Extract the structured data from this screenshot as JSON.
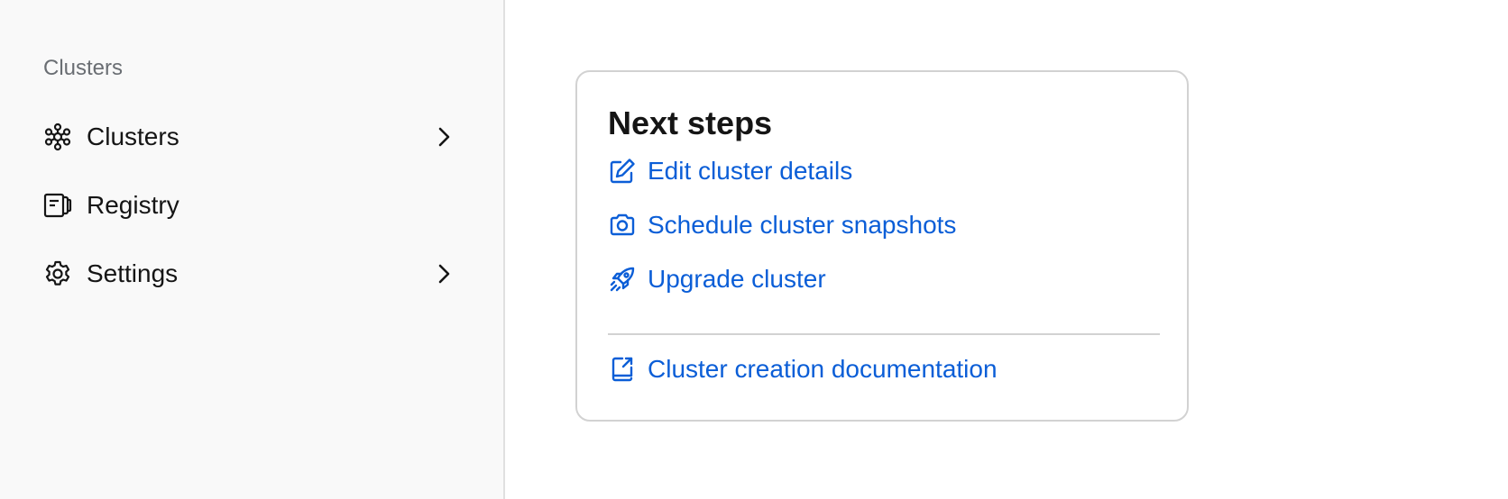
{
  "sidebar": {
    "heading": "Clusters",
    "items": [
      {
        "label": "Clusters",
        "icon": "clusters-icon",
        "has_submenu": true
      },
      {
        "label": "Registry",
        "icon": "registry-icon",
        "has_submenu": false
      },
      {
        "label": "Settings",
        "icon": "gear-icon",
        "has_submenu": true
      }
    ]
  },
  "card": {
    "title": "Next steps",
    "steps": [
      {
        "label": "Edit cluster details",
        "icon": "edit-icon"
      },
      {
        "label": "Schedule cluster snapshots",
        "icon": "camera-icon"
      },
      {
        "label": "Upgrade cluster",
        "icon": "rocket-icon"
      }
    ],
    "doc_link": {
      "label": "Cluster creation documentation",
      "icon": "external-doc-icon"
    }
  },
  "colors": {
    "link": "#0b5ed7",
    "sidebar_bg": "#f9f9f9",
    "text": "#151515",
    "muted": "#6a6e73"
  }
}
